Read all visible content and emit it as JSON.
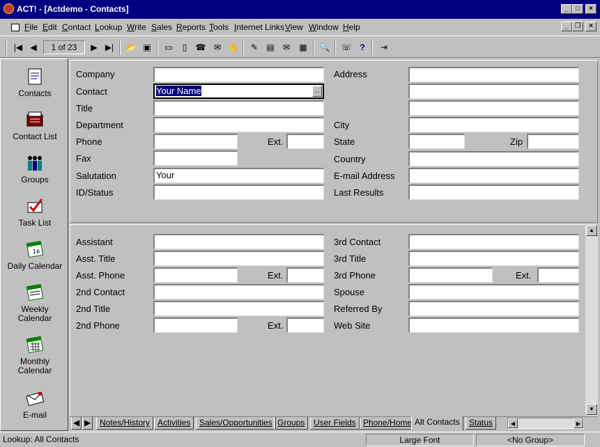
{
  "window": {
    "title": "ACT! - [Actdemo - Contacts]"
  },
  "menu": [
    "File",
    "Edit",
    "Contact",
    "Lookup",
    "Write",
    "Sales",
    "Reports",
    "Tools",
    "Internet Links",
    "View",
    "Window",
    "Help"
  ],
  "toolbar": {
    "record_counter": "1 of 23",
    "help_glyph": "?"
  },
  "nav": {
    "items": [
      {
        "label": "Contacts",
        "icon": "contacts-icon"
      },
      {
        "label": "Contact List",
        "icon": "contact-list-icon"
      },
      {
        "label": "Groups",
        "icon": "groups-icon"
      },
      {
        "label": "Task List",
        "icon": "task-list-icon"
      },
      {
        "label": "Daily Calendar",
        "icon": "daily-calendar-icon"
      },
      {
        "label": "Weekly Calendar",
        "icon": "weekly-calendar-icon"
      },
      {
        "label": "Monthly Calendar",
        "icon": "monthly-calendar-icon"
      },
      {
        "label": "E-mail",
        "icon": "email-icon"
      }
    ]
  },
  "upper": {
    "company_label": "Company",
    "company_value": "",
    "contact_label": "Contact",
    "contact_value": "Your Name",
    "title_label": "Title",
    "title_value": "",
    "department_label": "Department",
    "department_value": "",
    "phone_label": "Phone",
    "phone_value": "",
    "ext_label": "Ext.",
    "ext_value": "",
    "fax_label": "Fax",
    "fax_value": "",
    "salutation_label": "Salutation",
    "salutation_value": "Your",
    "idstatus_label": "ID/Status",
    "idstatus_value": "",
    "address_label": "Address",
    "address_value": "",
    "city_label": "City",
    "city_value": "",
    "state_label": "State",
    "state_value": "",
    "zip_label": "Zip",
    "zip_value": "",
    "country_label": "Country",
    "country_value": "",
    "email_label": "E-mail Address",
    "email_value": "",
    "lastresults_label": "Last Results",
    "lastresults_value": ""
  },
  "lower": {
    "assistant_label": "Assistant",
    "asst_title_label": "Asst. Title",
    "asst_phone_label": "Asst. Phone",
    "ext_label": "Ext.",
    "second_contact_label": "2nd Contact",
    "second_title_label": "2nd Title",
    "second_phone_label": "2nd Phone",
    "third_contact_label": "3rd Contact",
    "third_title_label": "3rd Title",
    "third_phone_label": "3rd Phone",
    "spouse_label": "Spouse",
    "referred_by_label": "Referred By",
    "web_site_label": "Web Site"
  },
  "tabs": [
    "Notes/History",
    "Activities",
    "Sales/Opportunities",
    "Groups",
    "User Fields",
    "Phone/Home",
    "Alt Contacts",
    "Status"
  ],
  "active_tab": "Alt Contacts",
  "status": {
    "lookup": "Lookup: All Contacts",
    "font": "Large Font",
    "group": "<No Group>"
  },
  "colors": {
    "titlebar": "#000080",
    "face": "#c0c0c0",
    "selection": "#000080"
  }
}
